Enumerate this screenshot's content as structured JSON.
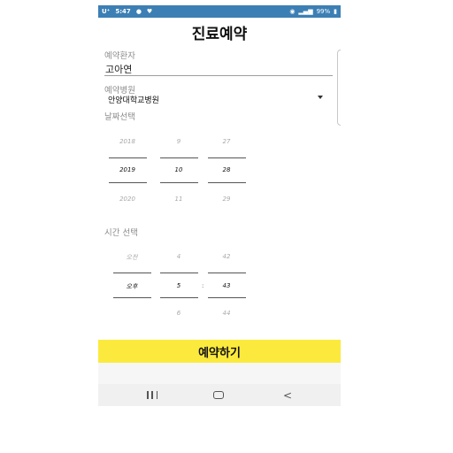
{
  "status_bar": {
    "carrier": "U⁺",
    "left_extra": "5:47",
    "right_text": "99%"
  },
  "screen_title": "진료예약",
  "form": {
    "patient_label": "예약환자",
    "patient_value": "고아연",
    "hospital_label": "예약병원",
    "hospital_value": "안양대학교병원",
    "date_label": "날짜선택",
    "time_label": "시간 선택"
  },
  "date_picker": {
    "year": {
      "prev": "2018",
      "selected": "2019",
      "next": "2020"
    },
    "month": {
      "prev": "9",
      "selected": "10",
      "next": "11"
    },
    "day": {
      "prev": "27",
      "selected": "28",
      "next": "29"
    }
  },
  "time_picker": {
    "ampm": {
      "prev": "오전",
      "selected": "오후"
    },
    "hour": {
      "prev": "4",
      "selected": "5",
      "next": "6"
    },
    "separator": ":",
    "minute": {
      "prev": "42",
      "selected": "43",
      "next": "44"
    }
  },
  "reserve_button": "예약하기",
  "nav": {
    "back_glyph": "<"
  }
}
